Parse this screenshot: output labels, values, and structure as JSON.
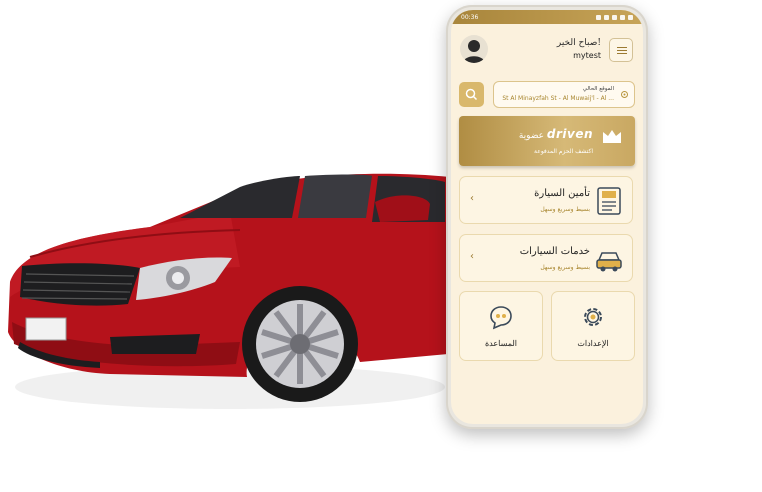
{
  "status_bar": {
    "time": "00:36"
  },
  "header": {
    "greeting": "صباح الخير!",
    "username": "mytest"
  },
  "location": {
    "label": "الموقع الحالي",
    "address": "St Al Minayzfah St - Al Muwaij'l - Al ..."
  },
  "membership": {
    "brand": "driven",
    "label": "عضوية",
    "subtitle": "اكتشف الحزم المدفوعة"
  },
  "services": [
    {
      "title": "تأمين السيارة",
      "subtitle": "بسيط وسريع وسهل"
    },
    {
      "title": "خدمات السيارات",
      "subtitle": "بسيط وسريع وسهل"
    }
  ],
  "tiles": [
    {
      "label": "الإعدادات",
      "icon": "gear-icon"
    },
    {
      "label": "المساعدة",
      "icon": "chat-icon"
    }
  ],
  "colors": {
    "gold": "#c7a458",
    "cream": "#fbf1dd",
    "car_red": "#b5121b"
  }
}
